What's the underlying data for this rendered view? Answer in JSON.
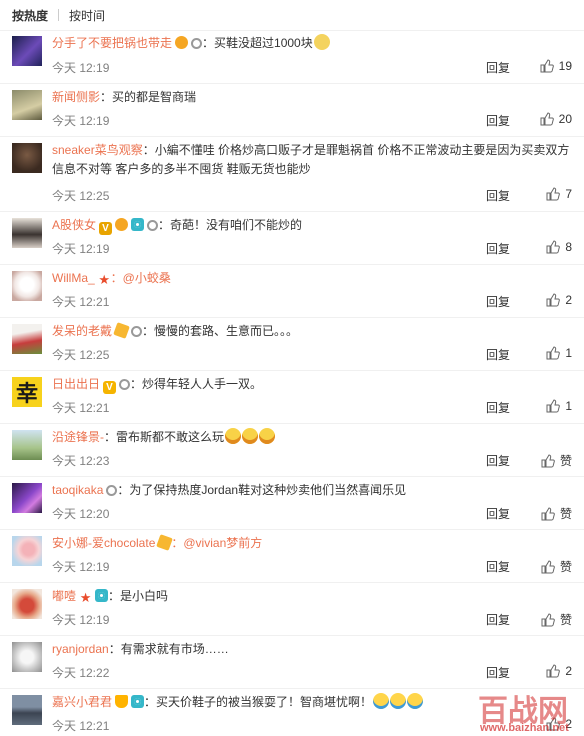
{
  "sort": {
    "hot": "按热度",
    "time": "按时间"
  },
  "reply_label": "回复",
  "zan_label": "赞",
  "comments": [
    {
      "user": "分手了不要把锅也带走",
      "text": "：买鞋没超过1000块",
      "time": "今天 12:19",
      "likes": "19"
    },
    {
      "user": "新闻侧影",
      "text": "：买的都是智商瑞",
      "time": "今天 12:19",
      "likes": "20"
    },
    {
      "user": "sneaker菜鸟观察",
      "text_line1": "：小編不懂哇 价格炒高口贩子才是罪魁祸首 价格不正常波动主要是因为买卖双方",
      "text_line2": "信息不对等 客户多的多半不囤货 鞋贩无货也能炒",
      "time": "今天 12:25",
      "likes": "7"
    },
    {
      "user": "A股侠女",
      "text": "：奇葩！没有咱们不能炒的",
      "time": "今天 12:19",
      "likes": "8"
    },
    {
      "user": "WillMa_",
      "text": "：@小蛟桑",
      "time": "今天 12:21",
      "likes": "2"
    },
    {
      "user": "发呆的老戴",
      "text": "：慢慢的套路、生意而已。。。",
      "time": "今天 12:25",
      "likes": "1"
    },
    {
      "user": "日出出日",
      "text": "：炒得年轻人人手一双。",
      "time": "今天 12:21",
      "likes": "1"
    },
    {
      "user": "沿途锋景-",
      "text": "：雷布斯都不敢这么玩",
      "time": "今天 12:23",
      "likes": ""
    },
    {
      "user": "taoqikaka",
      "text": "：为了保持热度Jordan鞋对这种炒卖他们当然喜闻乐见",
      "time": "今天 12:20",
      "likes": ""
    },
    {
      "user": "安小娜-爱chocolate",
      "text": "：@vivian梦前方",
      "time": "今天 12:19",
      "likes": ""
    },
    {
      "user": "嘟噎",
      "text": "：是小白吗",
      "time": "今天 12:19",
      "likes": ""
    },
    {
      "user": "ryanjordan",
      "text": "：有需求就有市场……",
      "time": "今天 12:22",
      "likes": "2"
    },
    {
      "user": "嘉兴小君君",
      "text": "：买天价鞋子的被当猴耍了！智商堪忧啊！",
      "time": "今天 12:21",
      "likes": "2"
    }
  ],
  "watermark": {
    "big": "百战网",
    "small": "www.baizhan.net"
  },
  "colors": {
    "username": "#eb7350",
    "meta": "#808080",
    "text": "#333333",
    "divider": "#f0f0f0"
  },
  "icons": {
    "like": "thumbs-up-icon",
    "reply": "text-link"
  }
}
